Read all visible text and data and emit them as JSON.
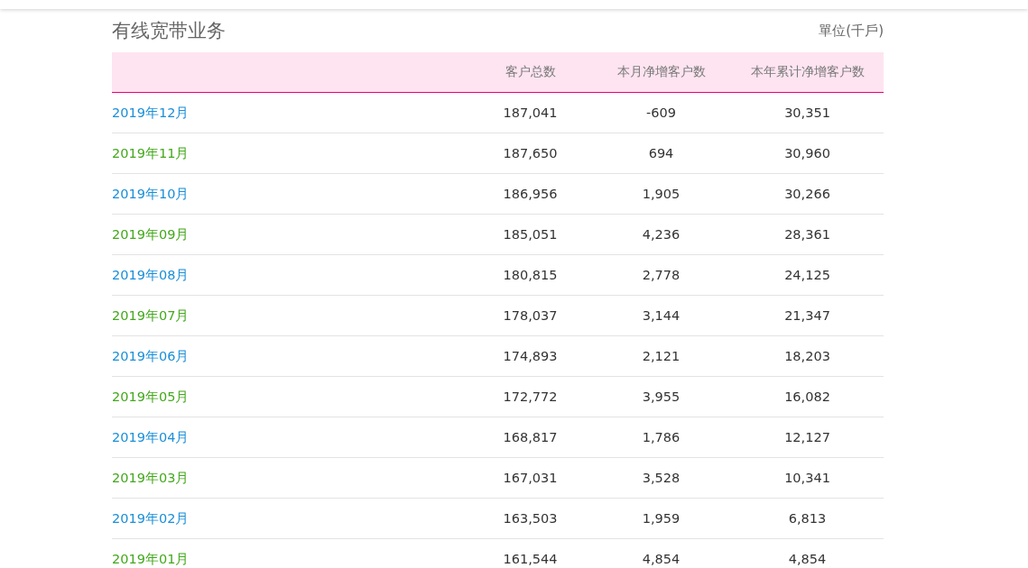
{
  "section": {
    "title": "有线宽带业务",
    "unit": "單位(千戶)"
  },
  "table": {
    "columns": [
      "客户总数",
      "本月净增客户数",
      "本年累计净增客户数"
    ],
    "rows": [
      {
        "month": "2019年12月",
        "color": "#1a8fd8",
        "cells": [
          "187,041",
          "-609",
          "30,351"
        ]
      },
      {
        "month": "2019年11月",
        "color": "#43a81c",
        "cells": [
          "187,650",
          "694",
          "30,960"
        ]
      },
      {
        "month": "2019年10月",
        "color": "#1a8fd8",
        "cells": [
          "186,956",
          "1,905",
          "30,266"
        ]
      },
      {
        "month": "2019年09月",
        "color": "#43a81c",
        "cells": [
          "185,051",
          "4,236",
          "28,361"
        ]
      },
      {
        "month": "2019年08月",
        "color": "#1a8fd8",
        "cells": [
          "180,815",
          "2,778",
          "24,125"
        ]
      },
      {
        "month": "2019年07月",
        "color": "#43a81c",
        "cells": [
          "178,037",
          "3,144",
          "21,347"
        ]
      },
      {
        "month": "2019年06月",
        "color": "#1a8fd8",
        "cells": [
          "174,893",
          "2,121",
          "18,203"
        ]
      },
      {
        "month": "2019年05月",
        "color": "#43a81c",
        "cells": [
          "172,772",
          "3,955",
          "16,082"
        ]
      },
      {
        "month": "2019年04月",
        "color": "#1a8fd8",
        "cells": [
          "168,817",
          "1,786",
          "12,127"
        ]
      },
      {
        "month": "2019年03月",
        "color": "#43a81c",
        "cells": [
          "167,031",
          "3,528",
          "10,341"
        ]
      },
      {
        "month": "2019年02月",
        "color": "#1a8fd8",
        "cells": [
          "163,503",
          "1,959",
          "6,813"
        ]
      },
      {
        "month": "2019年01月",
        "color": "#43a81c",
        "cells": [
          "161,544",
          "4,854",
          "4,854"
        ]
      }
    ]
  }
}
